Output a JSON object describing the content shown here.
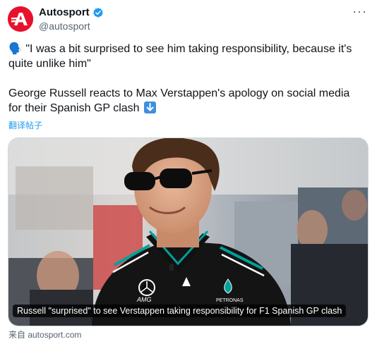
{
  "tweet": {
    "display_name": "Autosport",
    "handle": "@autosport",
    "text_line1": "🗣️ \"I was a bit surprised to see him taking responsibility, because it's quite unlike him\"",
    "text_line2": "George Russell reacts to Max Verstappen's apology on social media for their Spanish GP clash",
    "translate_label": "翻译帖子",
    "more_label": "···"
  },
  "card": {
    "caption": "Russell \"surprised\" to see Verstappen taking responsibility for F1 Spanish GP clash",
    "source": "来自 autosport.com",
    "brand_labels": [
      "AMG",
      "PETRONAS"
    ]
  },
  "colors": {
    "brand_red": "#e8112d",
    "verified_blue": "#1d9bf0",
    "link_blue": "#1d9bf0",
    "muted_gray": "#536471",
    "card_border": "#cfd9de",
    "shirt_black": "#111111",
    "petronas_teal": "#00a19b"
  },
  "icons": [
    "autosport-logo-icon",
    "verified-badge-icon",
    "more-options-icon",
    "speaking-head-icon",
    "down-arrow-icon"
  ]
}
